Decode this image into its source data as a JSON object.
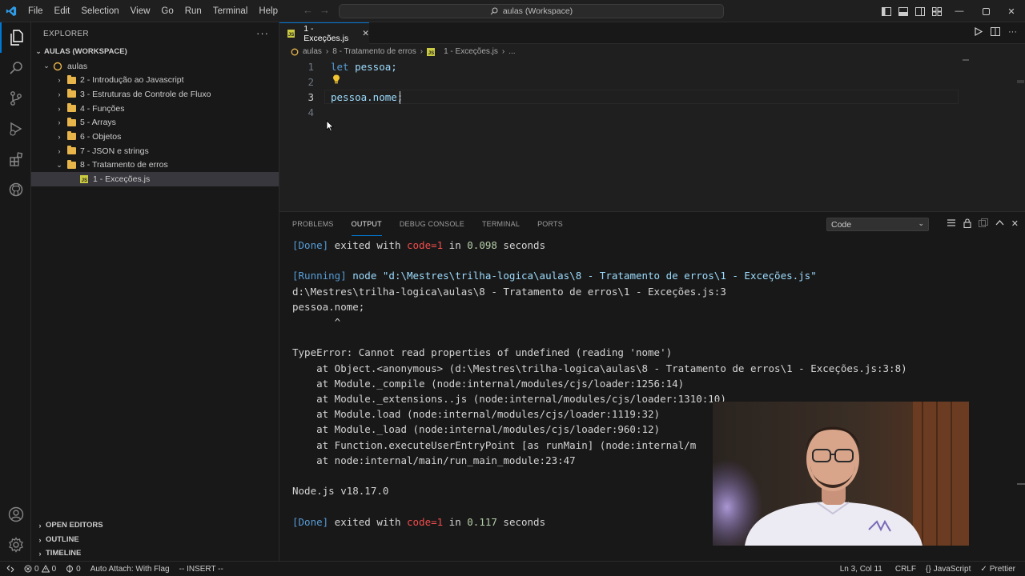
{
  "titlebar": {
    "menu": [
      "File",
      "Edit",
      "Selection",
      "View",
      "Go",
      "Run",
      "Terminal",
      "Help"
    ],
    "search_text": "aulas (Workspace)"
  },
  "sidebar": {
    "header": "EXPLORER",
    "workspace": "AULAS (WORKSPACE)",
    "root_folder": "aulas",
    "items": [
      {
        "label": "2 - Introdução ao Javascript",
        "type": "folder",
        "expanded": false
      },
      {
        "label": "3 - Estruturas de Controle de Fluxo",
        "type": "folder",
        "expanded": false
      },
      {
        "label": "4 - Funções",
        "type": "folder",
        "expanded": false
      },
      {
        "label": "5 - Arrays",
        "type": "folder",
        "expanded": false
      },
      {
        "label": "6 - Objetos",
        "type": "folder",
        "expanded": false
      },
      {
        "label": "7 - JSON e strings",
        "type": "folder",
        "expanded": false
      },
      {
        "label": "8 - Tratamento de erros",
        "type": "folder",
        "expanded": true
      },
      {
        "label": "1 - Exceções.js",
        "type": "file",
        "selected": true
      }
    ],
    "bottom_sections": [
      "OPEN EDITORS",
      "OUTLINE",
      "TIMELINE"
    ]
  },
  "editor": {
    "tab_label": "1 - Exceções.js",
    "breadcrumbs": [
      "aulas",
      "8 - Tratamento de erros",
      "1 - Exceções.js",
      "..."
    ],
    "lines": [
      {
        "num": "1",
        "kw": "let",
        "rest": " pessoa;"
      },
      {
        "num": "2",
        "kw": "",
        "rest": ""
      },
      {
        "num": "3",
        "kw": "",
        "rest": "pessoa.nome;"
      },
      {
        "num": "4",
        "kw": "",
        "rest": ""
      }
    ]
  },
  "panel": {
    "tabs": [
      "PROBLEMS",
      "OUTPUT",
      "DEBUG CONSOLE",
      "TERMINAL",
      "PORTS"
    ],
    "active_tab": "OUTPUT",
    "channel": "Code",
    "output": {
      "done1_tag": "[Done]",
      "done1_pre": " exited with ",
      "done1_code": "code=1",
      "done1_mid": " in ",
      "done1_time": "0.098",
      "done1_post": " seconds",
      "running_tag": "[Running]",
      "running_cmd": " node \"d:\\Mestres\\trilha-logica\\aulas\\8 - Tratamento de erros\\1 - Exceções.js\"",
      "l_path": "d:\\Mestres\\trilha-logica\\aulas\\8 - Tratamento de erros\\1 - Exceções.js:3",
      "l_code": "pessoa.nome;",
      "l_caret": "       ^",
      "l_error": "TypeError: Cannot read properties of undefined (reading 'nome')",
      "stack": [
        "    at Object.<anonymous> (d:\\Mestres\\trilha-logica\\aulas\\8 - Tratamento de erros\\1 - Exceções.js:3:8)",
        "    at Module._compile (node:internal/modules/cjs/loader:1256:14)",
        "    at Module._extensions..js (node:internal/modules/cjs/loader:1310:10)",
        "    at Module.load (node:internal/modules/cjs/loader:1119:32)",
        "    at Module._load (node:internal/modules/cjs/loader:960:12)",
        "    at Function.executeUserEntryPoint [as runMain] (node:internal/m",
        "    at node:internal/main/run_main_module:23:47"
      ],
      "node_version": "Node.js v18.17.0",
      "done2_tag": "[Done]",
      "done2_pre": " exited with ",
      "done2_code": "code=1",
      "done2_mid": " in ",
      "done2_time": "0.117",
      "done2_post": " seconds"
    }
  },
  "statusbar": {
    "errors": "0",
    "warnings": "0",
    "ports": "0",
    "auto_attach": "Auto Attach: With Flag",
    "mode": "-- INSERT --",
    "position": "Ln 3, Col 11",
    "eol": "CRLF",
    "language": "JavaScript",
    "formatter": "Prettier"
  },
  "colors": {
    "accent": "#0078d4",
    "folder": "#e8b54a",
    "js": "#cbcb41",
    "error": "#f14c4c",
    "keyword": "#569cd6"
  }
}
